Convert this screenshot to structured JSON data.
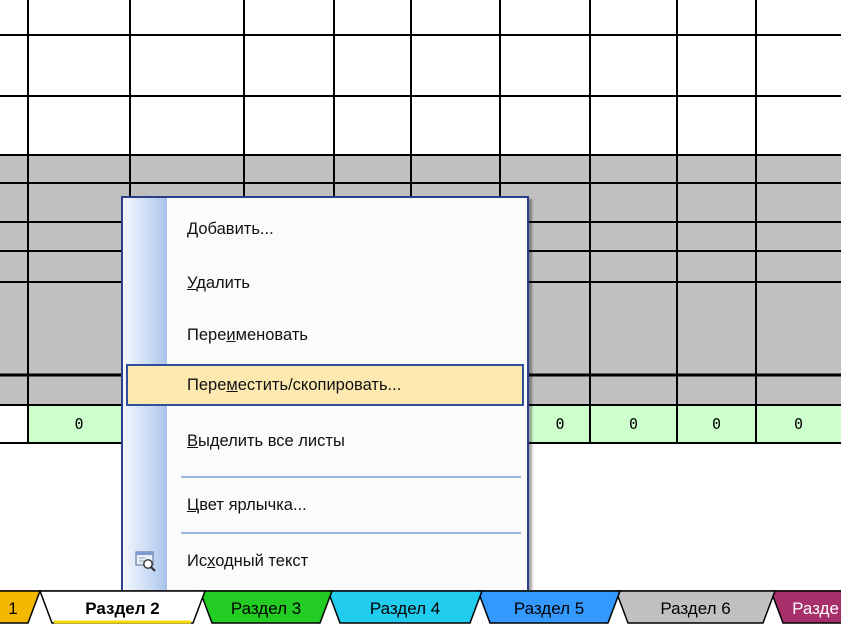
{
  "sheet": {
    "green_row_values": [
      "0",
      "0",
      "0",
      "0",
      "0"
    ]
  },
  "context_menu": {
    "items": [
      {
        "label": "Добавить...",
        "accel": "Д"
      },
      {
        "label": "Удалить",
        "accel": "У"
      },
      {
        "label": "Переименовать",
        "accel": "и"
      },
      {
        "label": "Переместить/скопировать...",
        "accel": "м",
        "highlighted": true
      },
      {
        "label": "Выделить все листы",
        "accel": "В"
      },
      {
        "label": "Цвет ярлычка...",
        "accel": "Ц"
      },
      {
        "label": "Исходный текст",
        "accel": "х",
        "icon": "view-code-icon"
      }
    ]
  },
  "tabs": [
    {
      "label": "1",
      "color": "#f5b800"
    },
    {
      "label": "Раздел 2",
      "color": "#ffffff",
      "active": true
    },
    {
      "label": "Раздел 3",
      "color": "#22cc22"
    },
    {
      "label": "Раздел 4",
      "color": "#22ccee"
    },
    {
      "label": "Раздел 5",
      "color": "#3399ff"
    },
    {
      "label": "Раздел 6",
      "color": "#c0c0c0"
    },
    {
      "label": "Разде",
      "color": "#a8306a"
    }
  ],
  "colors": {
    "gray_band": "#c0c0c0",
    "green_cells": "#ccffcc",
    "menu_border": "#2b3f8c",
    "menu_highlight": "#fde9b0"
  }
}
